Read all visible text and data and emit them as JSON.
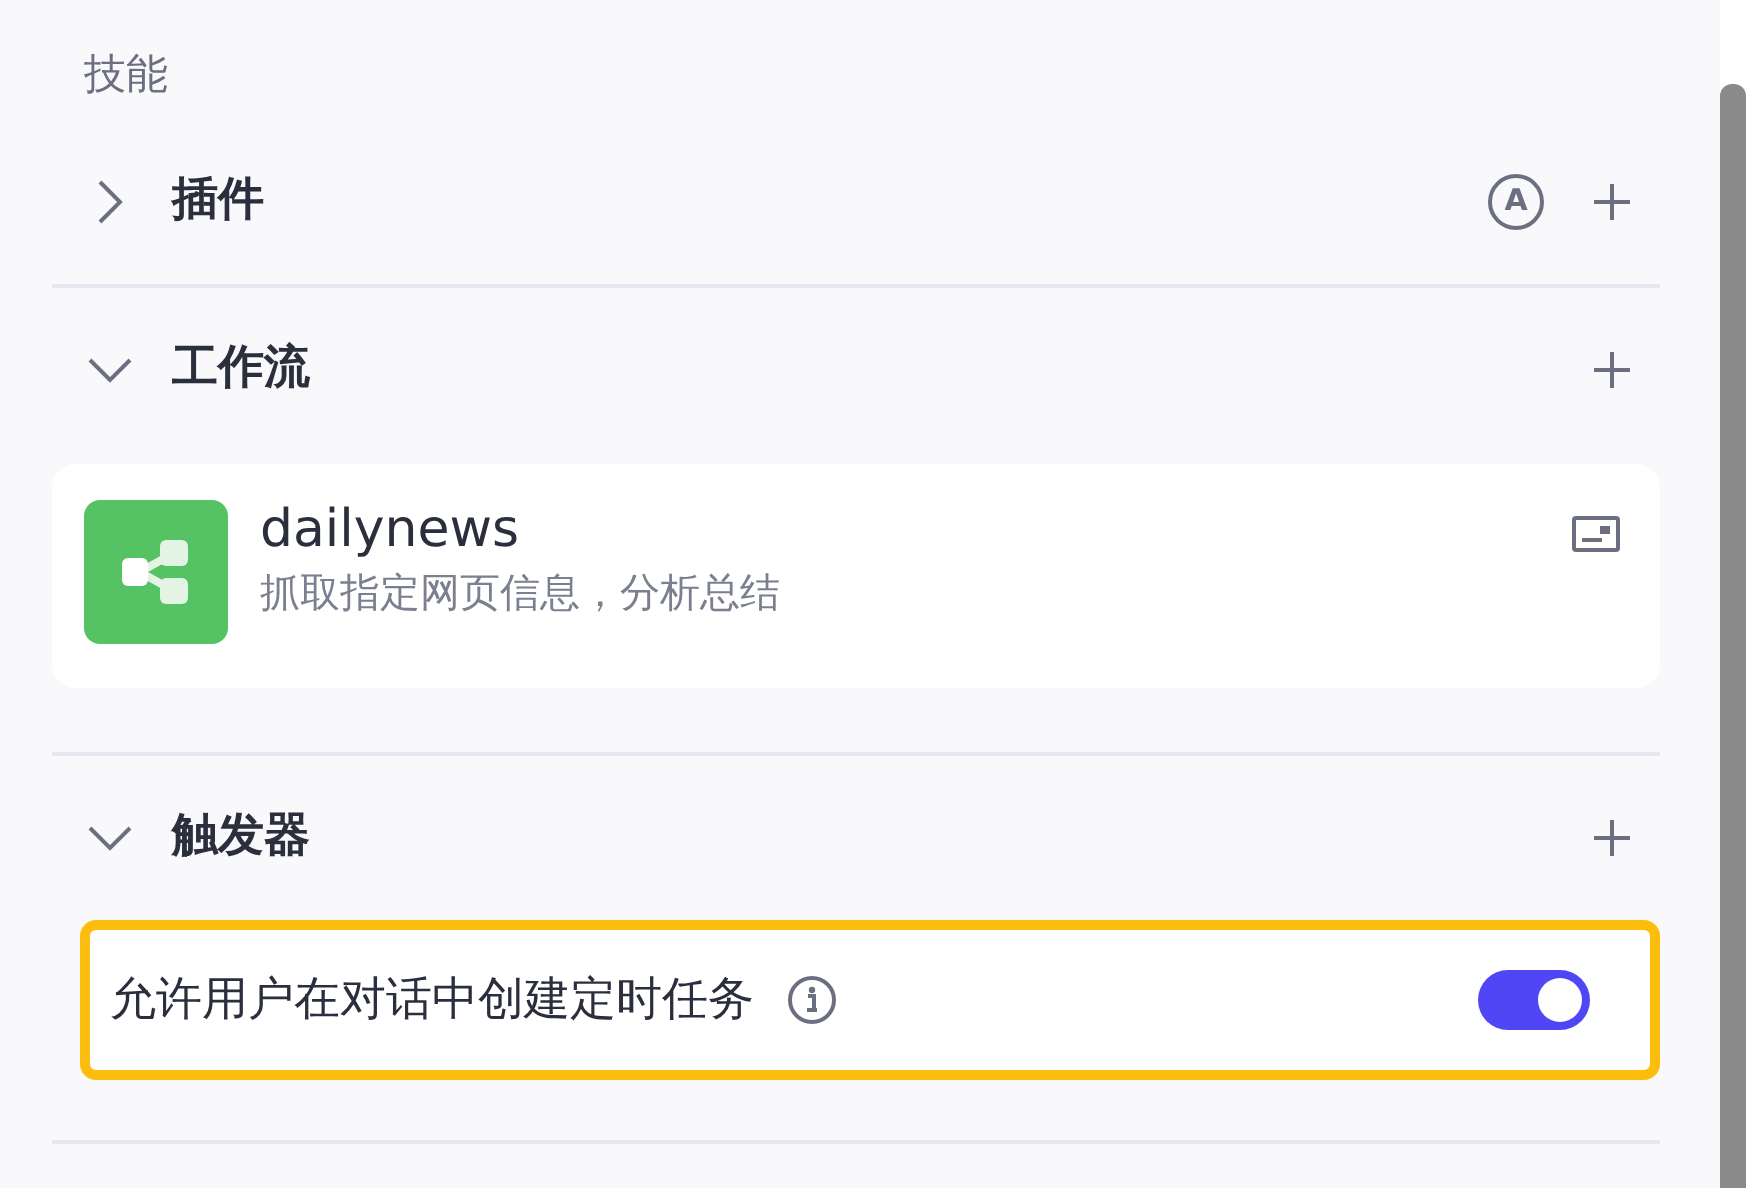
{
  "panel_title": "技能",
  "sections": [
    {
      "title": "插件",
      "expanded": false,
      "badge": "A"
    },
    {
      "title": "工作流",
      "expanded": true,
      "items": [
        {
          "kind": "workflow",
          "name": "dailynews",
          "description": "抓取指定网页信息，分析总结"
        }
      ]
    },
    {
      "title": "触发器",
      "expanded": true,
      "items": [
        {
          "kind": "toggle",
          "label": "允许用户在对话中创建定时任务",
          "on": true,
          "highlighted": true
        }
      ]
    }
  ]
}
